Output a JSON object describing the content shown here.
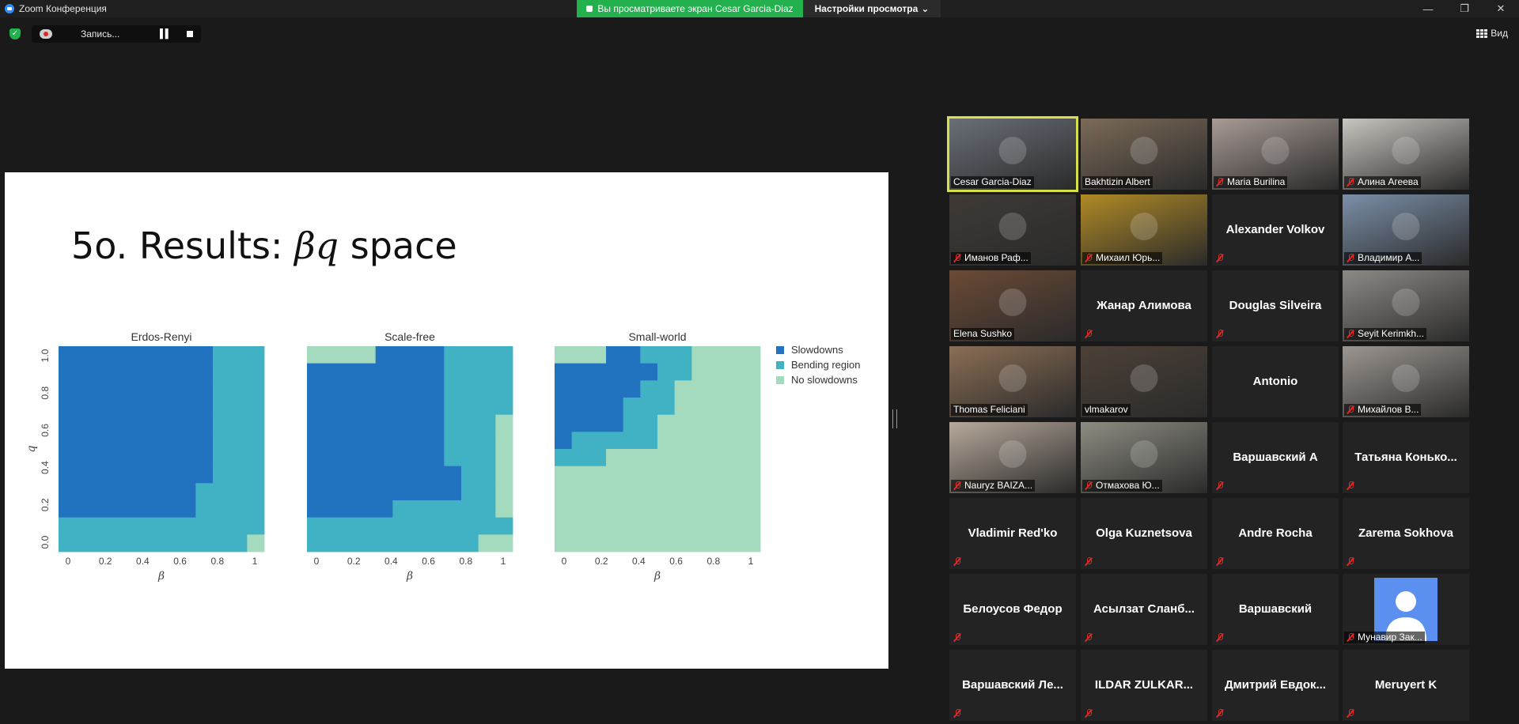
{
  "window": {
    "title": "Zoom Конференция",
    "share_banner": "Вы просматриваете экран Cesar Garcia-Diaz",
    "view_options": "Настройки просмотра",
    "controls": [
      "minimize-icon",
      "restore-icon",
      "close-icon"
    ]
  },
  "toolbar": {
    "recording_label": "Запись...",
    "view_label": "Вид"
  },
  "slide": {
    "title_prefix": "5o. Results: ",
    "title_symbol": "βq",
    "title_suffix": " space"
  },
  "colors": {
    "slowdowns": "#2173bf",
    "bending": "#40b2c4",
    "no_slowdowns": "#a4dbbe",
    "active_speaker": "#d7e04b",
    "share_green": "#22b14c"
  },
  "chart_data": [
    {
      "type": "heatmap",
      "title": "Erdos-Renyi",
      "xlabel": "β",
      "ylabel": "q",
      "x_ticks": [
        "0",
        "0.2",
        "0.4",
        "0.6",
        "0.8",
        "1"
      ],
      "y_ticks": [
        "0.0",
        "0.2",
        "0.4",
        "0.6",
        "0.8",
        "1.0"
      ],
      "categories": [
        "Slowdowns",
        "Bending region",
        "No slowdowns"
      ],
      "grid": [
        "SSSSSSSSSBBB",
        "SSSSSSSSSBBB",
        "SSSSSSSSSBBB",
        "SSSSSSSSSBBB",
        "SSSSSSSSSBBB",
        "SSSSSSSSSBBB",
        "SSSSSSSSSBBB",
        "SSSSSSSSSBBB",
        "SSSSSSSSBBBB",
        "SSSSSSSSBBBB",
        "BBBBBBBBBBBB",
        "BBBBBBBBBBBN"
      ]
    },
    {
      "type": "heatmap",
      "title": "Scale-free",
      "xlabel": "β",
      "ylabel": "",
      "x_ticks": [
        "0",
        "0.2",
        "0.4",
        "0.6",
        "0.8",
        "1"
      ],
      "y_ticks": [],
      "categories": [
        "Slowdowns",
        "Bending region",
        "No slowdowns"
      ],
      "grid": [
        "NNNNSSSSBBBB",
        "SSSSSSSSBBBB",
        "SSSSSSSSBBBB",
        "SSSSSSSSBBBB",
        "SSSSSSSSBBBN",
        "SSSSSSSSBBBN",
        "SSSSSSSSBBBN",
        "SSSSSSSSSBBN",
        "SSSSSSSSSBBN",
        "SSSSSBBBBBBN",
        "BBBBBBBBBBBB",
        "BBBBBBBBBBNN"
      ]
    },
    {
      "type": "heatmap",
      "title": "Small-world",
      "xlabel": "β",
      "ylabel": "",
      "x_ticks": [
        "0",
        "0.2",
        "0.4",
        "0.6",
        "0.8",
        "1"
      ],
      "y_ticks": [],
      "categories": [
        "Slowdowns",
        "Bending region",
        "No slowdowns"
      ],
      "grid": [
        "NNNSSBBBNNNN",
        "SSSSSSBBNNNN",
        "SSSSSBBNNNNN",
        "SSSSBBBNNNNN",
        "SSSSBBNNNNNN",
        "SBBBBBNNNNNN",
        "BBBNNNNNNNNN",
        "NNNNNNNNNNNN",
        "NNNNNNNNNNNN",
        "NNNNNNNNNNNN",
        "NNNNNNNNNNNN",
        "NNNNNNNNNNNN"
      ]
    }
  ],
  "legend": [
    {
      "label": "Slowdowns",
      "key": "slowdowns"
    },
    {
      "label": "Bending region",
      "key": "bending"
    },
    {
      "label": "No slowdowns",
      "key": "no_slowdowns"
    }
  ],
  "participants": [
    {
      "name": "Cesar Garcia-Diaz",
      "video": true,
      "muted": false,
      "active": true,
      "bg": "#6a6f78"
    },
    {
      "name": "Bakhtizin Albert",
      "video": true,
      "muted": false,
      "active": false,
      "bg": "#7b6a58"
    },
    {
      "name": "Maria Burilina",
      "video": true,
      "muted": true,
      "active": false,
      "bg": "#a89b95"
    },
    {
      "name": "Алина Агеева",
      "video": true,
      "muted": true,
      "active": false,
      "bg": "#c9c5c0"
    },
    {
      "name": "Иманов Раф...",
      "video": true,
      "muted": true,
      "active": false,
      "bg": "#3f3a36"
    },
    {
      "name": "Михаил Юрь...",
      "video": true,
      "muted": true,
      "active": false,
      "bg": "#b08a26"
    },
    {
      "name": "Alexander Volkov",
      "video": false,
      "muted": true,
      "active": false
    },
    {
      "name": "Владимир А...",
      "video": true,
      "muted": true,
      "active": false,
      "bg": "#7b8fa8"
    },
    {
      "name": "Elena Sushko",
      "video": true,
      "muted": false,
      "active": false,
      "bg": "#6b4a36"
    },
    {
      "name": "Жанар Алимова",
      "video": false,
      "muted": true,
      "active": false
    },
    {
      "name": "Douglas Silveira",
      "video": false,
      "muted": true,
      "active": false
    },
    {
      "name": "Seyit Kerimkh...",
      "video": true,
      "muted": true,
      "active": false,
      "bg": "#8d8a86"
    },
    {
      "name": "Thomas Feliciani",
      "video": true,
      "muted": false,
      "active": false,
      "bg": "#8b6e55"
    },
    {
      "name": "vlmakarov",
      "video": true,
      "muted": false,
      "active": false,
      "bg": "#4c4137"
    },
    {
      "name": "Antonio",
      "video": false,
      "muted": false,
      "active": false
    },
    {
      "name": "Михайлов В...",
      "video": true,
      "muted": true,
      "active": false,
      "bg": "#9c9691"
    },
    {
      "name": "Nauryz BAIZA...",
      "video": true,
      "muted": true,
      "active": false,
      "bg": "#b7a99b"
    },
    {
      "name": "Отмахова Ю...",
      "video": true,
      "muted": true,
      "active": false,
      "bg": "#8d8d82"
    },
    {
      "name": "Варшавский А",
      "video": false,
      "muted": true,
      "active": false
    },
    {
      "name": "Татьяна Конько...",
      "video": false,
      "muted": true,
      "active": false
    },
    {
      "name": "Vladimir Red'ko",
      "video": false,
      "muted": true,
      "active": false
    },
    {
      "name": "Olga Kuznetsova",
      "video": false,
      "muted": true,
      "active": false
    },
    {
      "name": "Andre Rocha",
      "video": false,
      "muted": true,
      "active": false
    },
    {
      "name": "Zarema Sokhova",
      "video": false,
      "muted": true,
      "active": false
    },
    {
      "name": "Белоусов Федор",
      "video": false,
      "muted": true,
      "active": false
    },
    {
      "name": "Асылзат Сланб...",
      "video": false,
      "muted": true,
      "active": false
    },
    {
      "name": "Варшавский",
      "video": false,
      "muted": true,
      "active": false
    },
    {
      "name": "Мунавир Зак...",
      "video": true,
      "avatar": true,
      "muted": true,
      "active": false
    },
    {
      "name": "Варшавский Ле...",
      "video": false,
      "muted": true,
      "active": false
    },
    {
      "name": "ILDAR ZULKAR...",
      "video": false,
      "muted": true,
      "active": false
    },
    {
      "name": "Дмитрий Евдок...",
      "video": false,
      "muted": true,
      "active": false
    },
    {
      "name": "Meruyert K",
      "video": false,
      "muted": true,
      "active": false
    }
  ]
}
